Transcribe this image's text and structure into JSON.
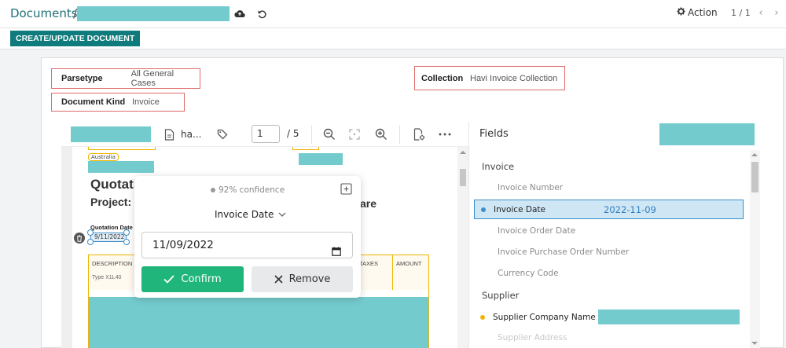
{
  "header": {
    "breadcrumb": "Documents",
    "breadcrumb_sep": "/",
    "action_label": "Action",
    "pager": "1 / 1"
  },
  "toolbar": {
    "create_label": "CREATE/UPDATE DOCUMENT"
  },
  "meta": {
    "parsetype_label": "Parsetype",
    "parsetype_value": "All General Cases",
    "collection_label": "Collection",
    "collection_value": "Havi Invoice Collection",
    "doc_kind_label": "Document Kind",
    "doc_kind_value": "Invoice"
  },
  "viewer": {
    "file_name": "ha...",
    "page_current": "1",
    "page_total": "/  5"
  },
  "pdf": {
    "country": "Australia",
    "title": "Quotati",
    "project": "Project: I",
    "title_tail": "are",
    "quote_date_label": "Quotation Date",
    "quote_date_value": "9/11/2022",
    "col_description": "DESCRIPTION",
    "col_taxes": "TAXES",
    "col_amount": "AMOUNT",
    "item_type": "Type X1L40"
  },
  "popup": {
    "confidence": "92% confidence",
    "field_name": "Invoice Date",
    "date_value": "11/09/2022",
    "confirm_label": "Confirm",
    "remove_label": "Remove"
  },
  "fields_panel": {
    "title": "Fields",
    "groups": [
      {
        "name": "Invoice",
        "items": [
          "Invoice Number",
          "Invoice Date",
          "Invoice Order Date",
          "Invoice Purchase Order Number",
          "Currency Code"
        ]
      },
      {
        "name": "Supplier",
        "items": [
          "Supplier Company Name",
          "Supplier Address"
        ]
      }
    ],
    "selected_value": "2022-11-09"
  },
  "colors": {
    "brand": "#0f7b7c",
    "accent_link": "#1f6f79",
    "confirm_green": "#1fb57b",
    "selected_bg": "#cfe6f5",
    "selected_border": "#3e8ec7",
    "dot_blue": "#3e8ec7",
    "dot_yellow": "#f0b400",
    "redaction": "#74cbcd",
    "annotation_red": "#e06a6a"
  }
}
